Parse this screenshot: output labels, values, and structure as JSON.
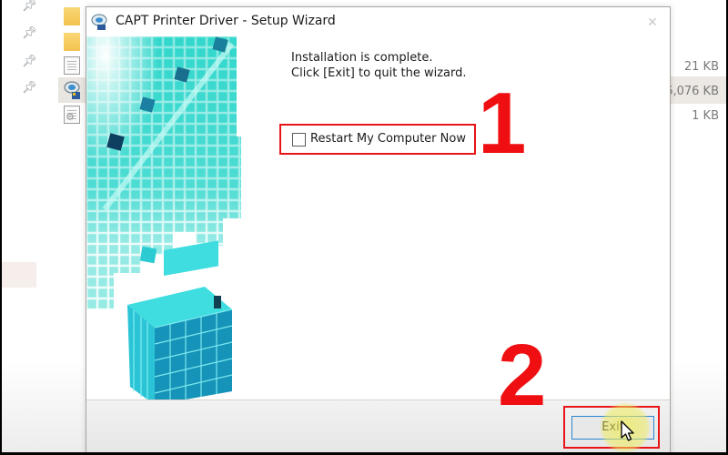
{
  "explorer": {
    "file_sizes": [
      "21 KB",
      "6,076 KB",
      "1 KB"
    ],
    "file_icons": [
      "folder-icon",
      "folder-icon",
      "document-icon",
      "setup-icon",
      "settings-file-icon"
    ]
  },
  "dialog": {
    "title": "CAPT Printer Driver - Setup Wizard",
    "message_line1": "Installation is complete.",
    "message_line2": "Click [Exit] to quit the wizard.",
    "restart_checkbox": {
      "label": "Restart My Computer Now",
      "checked": false
    },
    "exit_button": "Exit"
  },
  "annotations": {
    "step1": "1",
    "step2": "2",
    "highlight_color": "#e8141a"
  }
}
